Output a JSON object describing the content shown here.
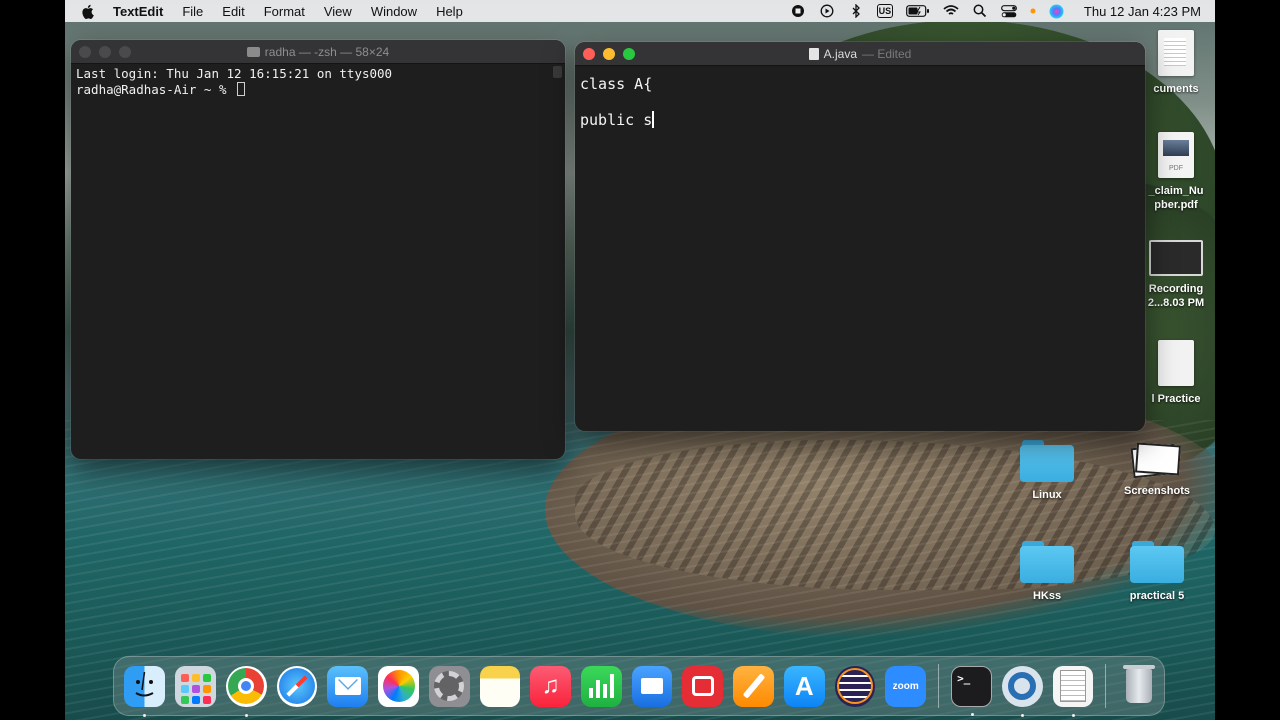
{
  "menubar": {
    "app_name": "TextEdit",
    "menus": [
      "File",
      "Edit",
      "Format",
      "View",
      "Window",
      "Help"
    ],
    "input_source": "US",
    "clock": "Thu 12 Jan  4:23 PM",
    "status_icons": [
      "screen-record-icon",
      "play-icon",
      "bluetooth-icon",
      "keyboard-input-icon",
      "battery-icon",
      "wifi-icon",
      "search-icon",
      "control-center-icon",
      "siri-icon"
    ]
  },
  "terminal": {
    "title": "radha — -zsh — 58×24",
    "lines": [
      "Last login: Thu Jan 12 16:15:21 on ttys000",
      "radha@Radhas-Air ~ % "
    ]
  },
  "textedit": {
    "title": "A.java",
    "status": "— Edited",
    "lines": [
      "class A{",
      "",
      "public s"
    ]
  },
  "desktop": {
    "items": [
      {
        "label": "cuments",
        "icon": "document-icon"
      },
      {
        "label": "_claim_Nu\npber.pdf",
        "icon": "pdf-icon"
      },
      {
        "label": "Recording\n2...8.03 PM",
        "icon": "recording-icon"
      },
      {
        "label": "l Practice",
        "icon": "document-icon"
      },
      {
        "label": "Linux",
        "icon": "folder-icon"
      },
      {
        "label": "Screenshots",
        "icon": "screenshots-icon"
      },
      {
        "label": "HKss",
        "icon": "folder-icon"
      },
      {
        "label": "practical 5",
        "icon": "folder-icon"
      }
    ]
  },
  "dock": {
    "apps": [
      "Finder",
      "Launchpad",
      "Google Chrome",
      "Safari",
      "Mail",
      "Photos",
      "System Settings",
      "Notes",
      "Music",
      "Numbers",
      "Keynote",
      "Photo Booth",
      "Pages",
      "App Store",
      "Eclipse",
      "zoom.us",
      "Terminal",
      "QuickTime Player",
      "TextEdit",
      "Trash"
    ],
    "zoom_label": "zoom",
    "terminal_label": ">_"
  }
}
